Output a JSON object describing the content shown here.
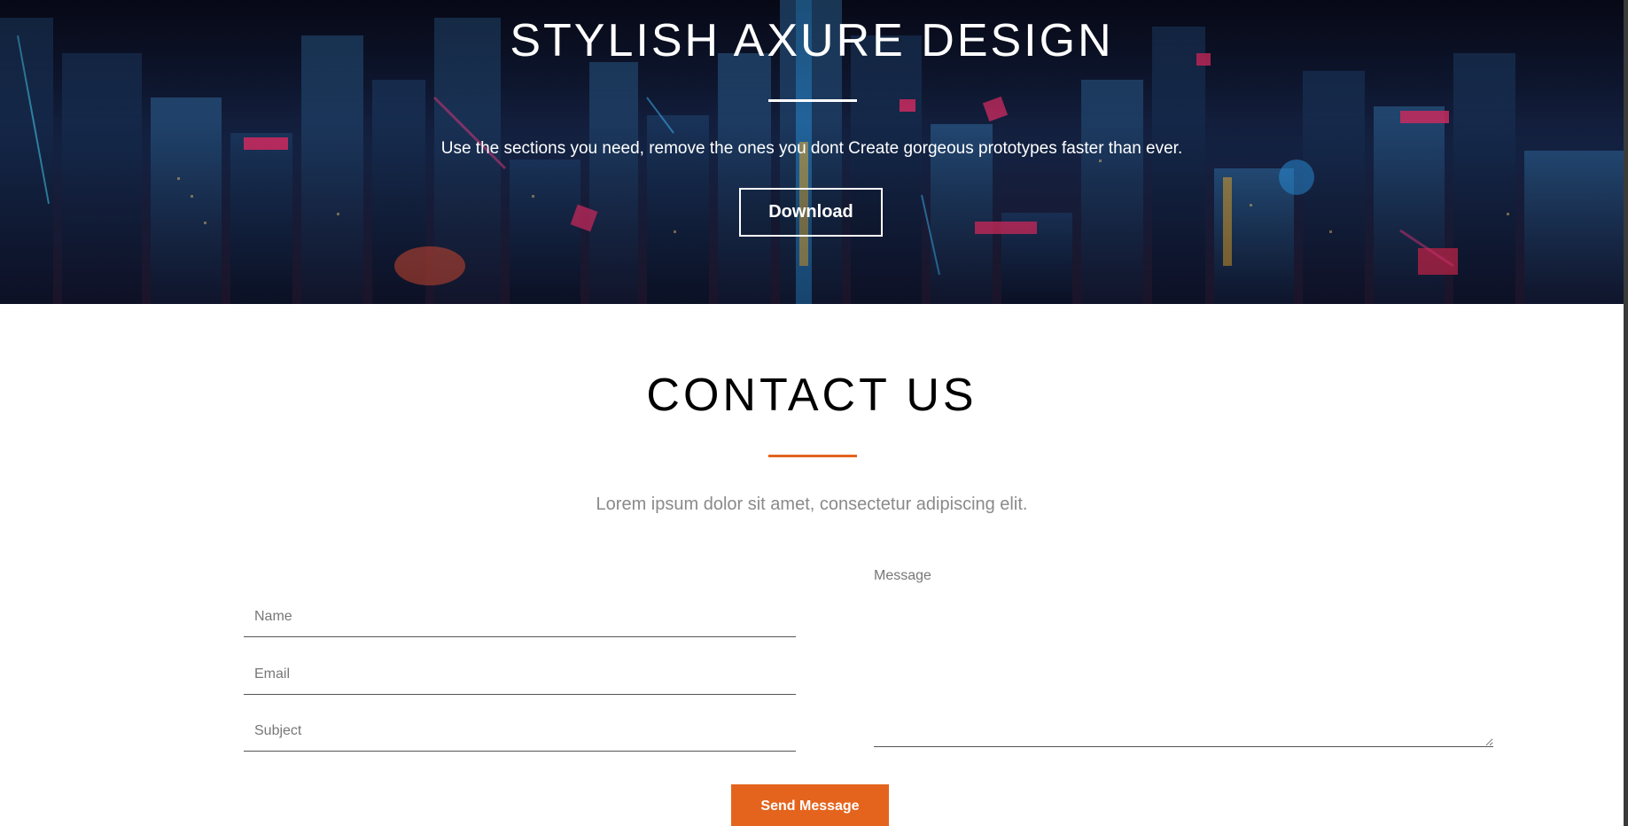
{
  "hero": {
    "title": "STYLISH AXURE DESIGN",
    "subtitle": "Use the sections you need, remove the ones you dont Create gorgeous prototypes faster than ever.",
    "download_label": "Download"
  },
  "contact": {
    "title": "CONTACT US",
    "subtitle": "Lorem ipsum dolor sit amet, consectetur adipiscing elit.",
    "name_placeholder": "Name",
    "email_placeholder": "Email",
    "subject_placeholder": "Subject",
    "message_placeholder": "Message",
    "send_label": "Send Message"
  },
  "colors": {
    "accent": "#e4641e",
    "hero_text": "#ffffff",
    "muted_text": "#8a8a8a"
  }
}
